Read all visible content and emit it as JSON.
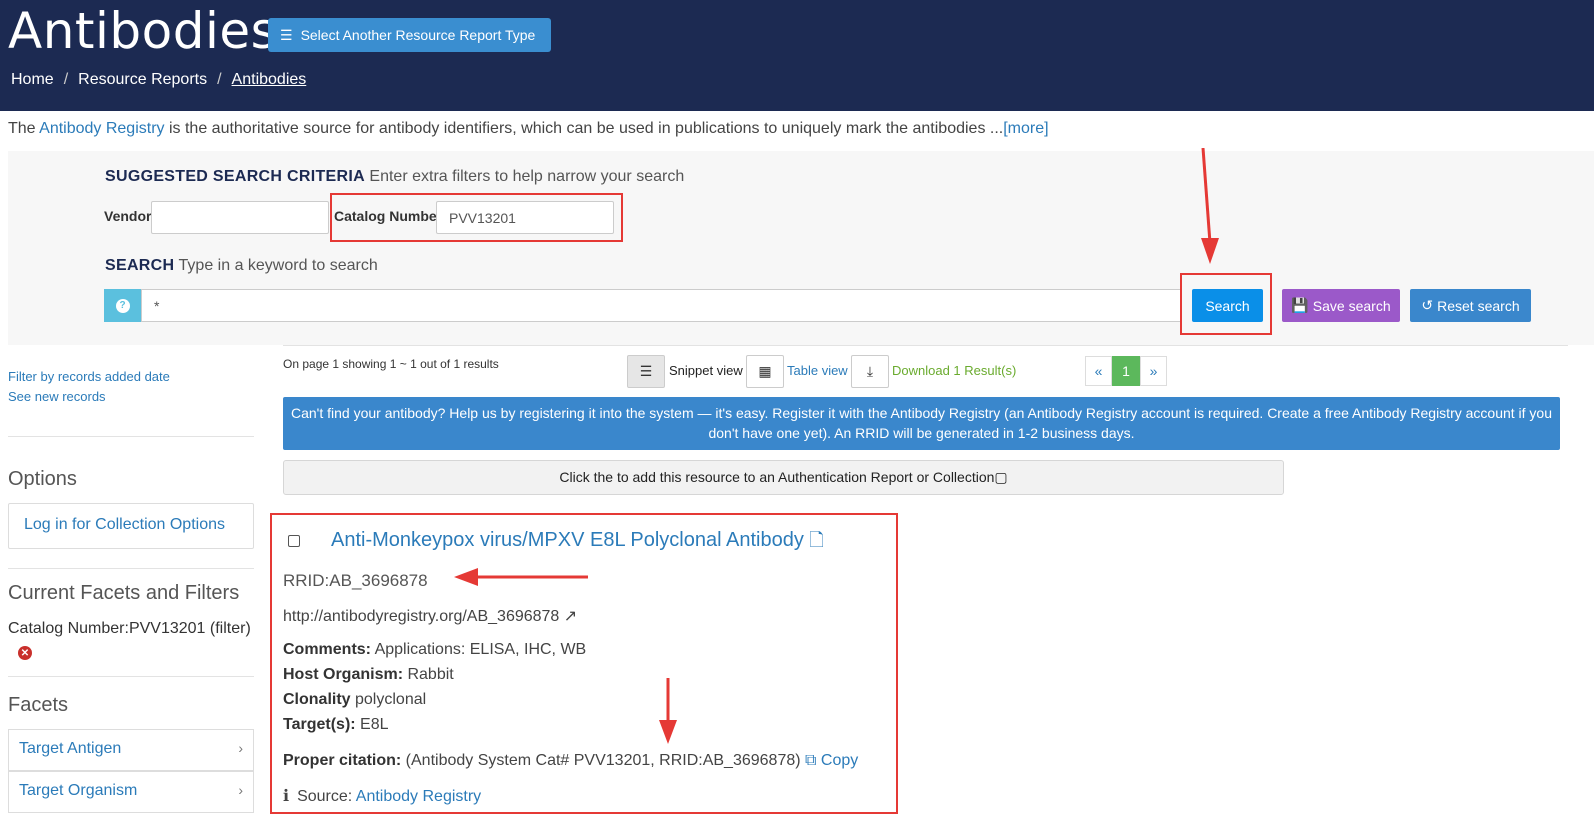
{
  "header": {
    "title": "Antibodies",
    "select_type_button": "Select Another Resource Report Type",
    "breadcrumb": [
      "Home",
      "Resource Reports",
      "Antibodies"
    ]
  },
  "intro": {
    "prefix": "The ",
    "registry_link": "Antibody Registry",
    "text": " is the authoritative source for antibody identifiers, which can be used in publications to uniquely mark the antibodies ...",
    "more_link": "[more]"
  },
  "criteria": {
    "heading": "SUGGESTED SEARCH CRITERIA",
    "hint": " Enter extra filters to help narrow your search",
    "vendor_label": "Vendor",
    "vendor_value": "",
    "catalog_label": "Catalog Number",
    "catalog_value": "PVV13201",
    "search_heading": "SEARCH",
    "search_hint": " Type in a keyword to search",
    "keyword_value": "*",
    "help_icon": "?",
    "search_button": "Search",
    "save_button": "Save search",
    "reset_button": "Reset search"
  },
  "sidebar": {
    "filter_by_date": "Filter by records added date",
    "see_new": "See new records",
    "options_heading": "Options",
    "login_link": "Log in for Collection Options",
    "facets_filters_heading": "Current Facets and Filters",
    "active_filter": "Catalog Number:PVV13201 (filter)",
    "facets_heading": "Facets",
    "facets": [
      "Target Antigen",
      "Target Organism"
    ]
  },
  "results": {
    "summary": "On page 1 showing 1 ~ 1 out of 1 results",
    "snippet_view": "Snippet view",
    "table_view": "Table view",
    "download": "Download 1 Result(s)",
    "pager": [
      "«",
      "1",
      "»"
    ],
    "register_banner": "Can't find your antibody? Help us by registering it into the system — it's easy. Register it with the Antibody Registry (an Antibody Registry account is required. Create a free Antibody Registry account if you don't have one yet). An RRID will be generated in 1-2 business days.",
    "auth_bar": "Click the to add this resource to an Authentication Report or Collection▢"
  },
  "record": {
    "title": "Anti-Monkeypox virus/MPXV E8L Polyclonal Antibody",
    "rrid": "RRID:AB_3696878",
    "url": "http://antibodyregistry.org/AB_3696878",
    "comments_label": "Comments:",
    "comments": " Applications: ELISA, IHC, WB",
    "host_label": "Host Organism:",
    "host": " Rabbit",
    "clonality_label": "Clonality",
    "clonality": " polyclonal",
    "targets_label": "Target(s):",
    "targets": " E8L",
    "citation_label": "Proper citation:",
    "citation": " (Antibody System Cat# PVV13201, RRID:AB_3696878)",
    "copy": "Copy",
    "source_icon": "ℹ",
    "source_label": "Source: ",
    "source": "Antibody Registry"
  },
  "colors": {
    "header_bg": "#1c2a52",
    "link": "#2b7bb9",
    "search_btn": "#0a8fe8",
    "save_btn": "#9b59c9",
    "reset_btn": "#3a87cc",
    "annotation_red": "#e53935"
  }
}
